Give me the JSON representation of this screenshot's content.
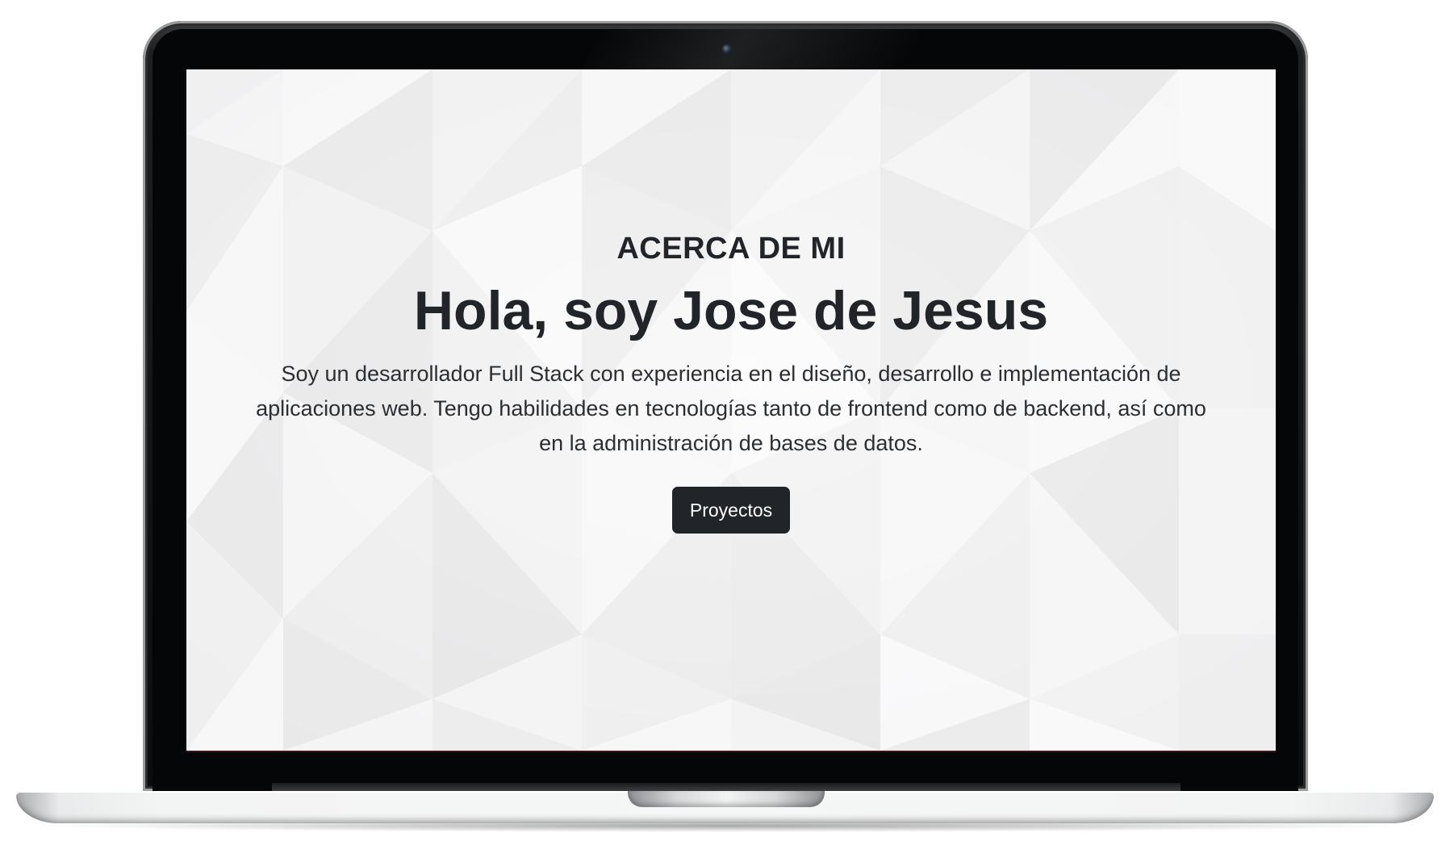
{
  "hero": {
    "eyebrow": "ACERCA DE MI",
    "headline": "Hola, soy Jose de Jesus",
    "lead": "Soy un desarrollador Full Stack con experiencia en el diseño, desarrollo e implementación de aplicaciones web. Tengo habilidades en tecnologías tanto de frontend como de backend, así como en la administración de bases de datos.",
    "cta_label": "Proyectos"
  },
  "colors": {
    "text": "#212529",
    "button_bg": "#212529",
    "button_text": "#ffffff",
    "screen_bg": "#f3f3f4",
    "bezel": "#0b0c0d"
  },
  "icons": {
    "camera": "webcam-icon"
  }
}
